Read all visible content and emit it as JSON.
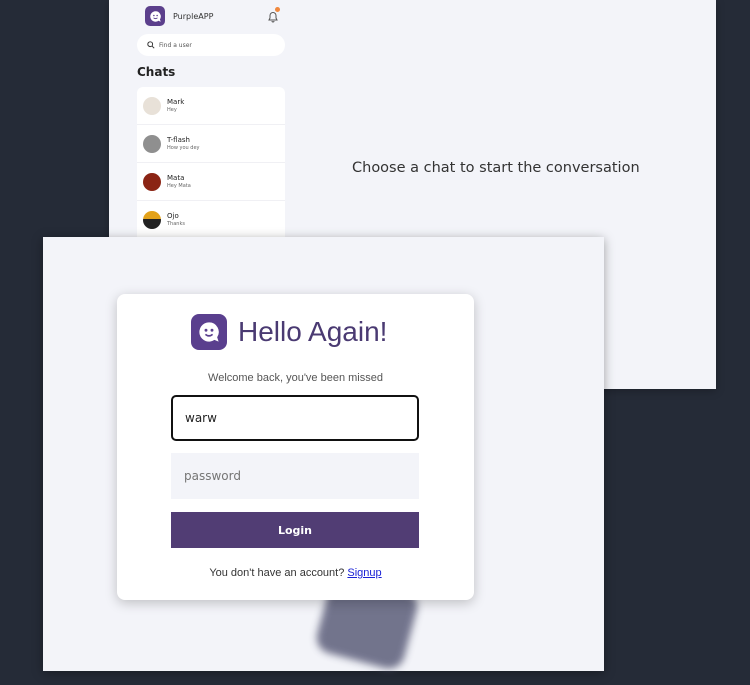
{
  "chat_app": {
    "app_name": "PurpleAPP",
    "search_placeholder": "Find a user",
    "chats_title": "Chats",
    "chats": [
      {
        "name": "Mark",
        "message": "Hey"
      },
      {
        "name": "T-flash",
        "message": "How you dey"
      },
      {
        "name": "Mata",
        "message": "Hey Mata"
      },
      {
        "name": "Ojo",
        "message": "Thanks"
      }
    ],
    "empty_state": "Choose a chat to start the conversation"
  },
  "login": {
    "title": "Hello Again!",
    "subtitle": "Welcome back, you've been missed",
    "username_value": "warw",
    "password_placeholder": "password",
    "login_label": "Login",
    "signup_prompt": "You don't have an account?",
    "signup_link": "Signup"
  },
  "colors": {
    "background": "#252b37",
    "brand_purple": "#5a3f8e",
    "button": "#513d74",
    "link": "#1a22d6"
  }
}
